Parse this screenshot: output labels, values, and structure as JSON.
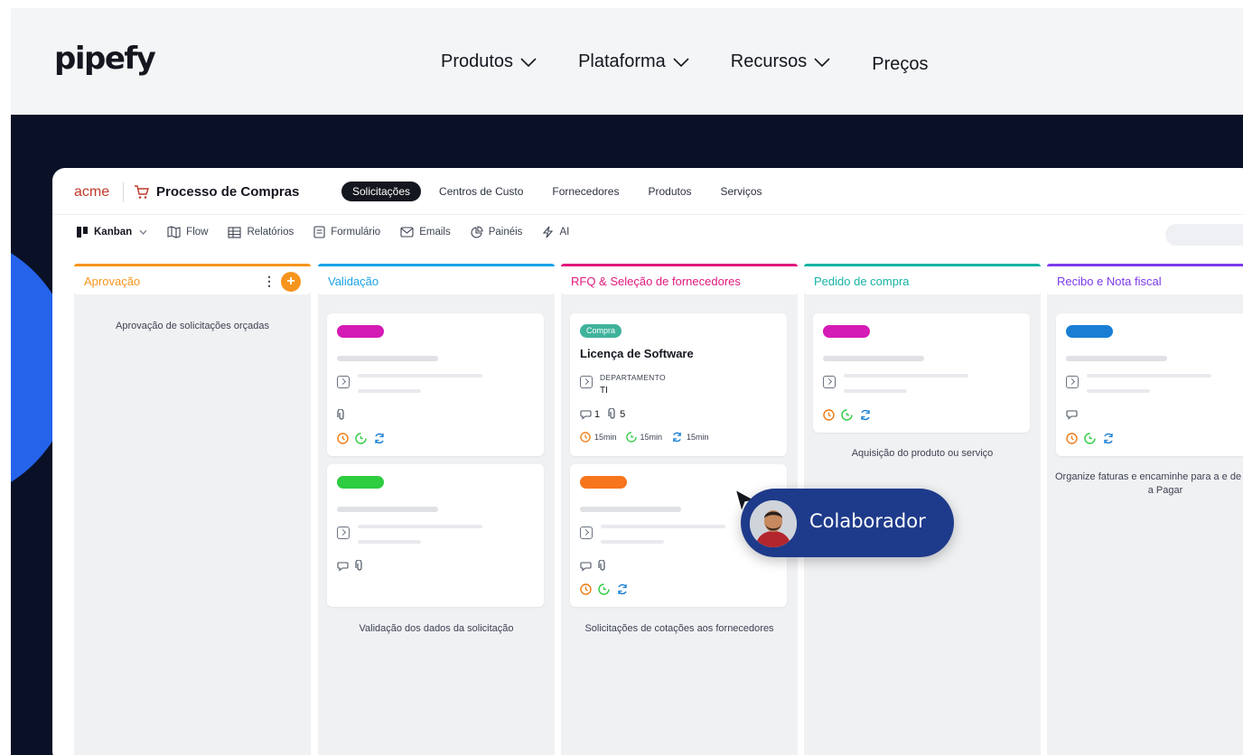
{
  "site": {
    "logo": "pipefy",
    "nav": [
      {
        "label": "Produtos",
        "dropdown": true
      },
      {
        "label": "Plataforma",
        "dropdown": true
      },
      {
        "label": "Recursos",
        "dropdown": true
      },
      {
        "label": "Preços",
        "dropdown": false
      }
    ]
  },
  "app": {
    "org": "acme",
    "process_title": "Processo de Compras",
    "tabs": [
      {
        "label": "Solicitações",
        "active": true
      },
      {
        "label": "Centros de Custo",
        "active": false
      },
      {
        "label": "Fornecedores",
        "active": false
      },
      {
        "label": "Produtos",
        "active": false
      },
      {
        "label": "Serviços",
        "active": false
      }
    ],
    "tools": [
      {
        "label": "Kanban",
        "icon": "kanban-icon",
        "active": true
      },
      {
        "label": "Flow",
        "icon": "map-icon"
      },
      {
        "label": "Relatórios",
        "icon": "table-icon"
      },
      {
        "label": "Formulário",
        "icon": "form-icon"
      },
      {
        "label": "Emails",
        "icon": "mail-icon"
      },
      {
        "label": "Painéis",
        "icon": "pie-chart-icon"
      },
      {
        "label": "AI",
        "icon": "bolt-icon"
      }
    ]
  },
  "columns": [
    {
      "title": "Aprovação",
      "color": "#f7941d",
      "description": "Aprovação de solicitações orçadas"
    },
    {
      "title": "Validação",
      "color": "#1aa3e8",
      "description": "Validação dos dados da solicitação"
    },
    {
      "title": "RFQ & Seleção de fornecedores",
      "color": "#e0197d",
      "description": "Solicitações de cotações aos fornecedores"
    },
    {
      "title": "Pedido de compra",
      "color": "#17b3a3",
      "description": "Aquisição do produto ou serviço"
    },
    {
      "title": "Recibo e Nota fiscal",
      "color": "#7c3aed",
      "description": "Organize faturas e encaminhe para a e de Contas a Pagar"
    }
  ],
  "card_colors": {
    "magenta": "#d41bb5",
    "green": "#2ecc40",
    "orange": "#f7751d",
    "blue": "#1a7fd4"
  },
  "featured_card": {
    "tag": "Compra",
    "title": "Licença de Software",
    "field_label": "DEPARTAMENTO",
    "field_value": "TI",
    "comments": "1",
    "attachments": "5",
    "timers": [
      "15min",
      "15min",
      "15min"
    ]
  },
  "collaborator": {
    "label": "Colaborador"
  }
}
